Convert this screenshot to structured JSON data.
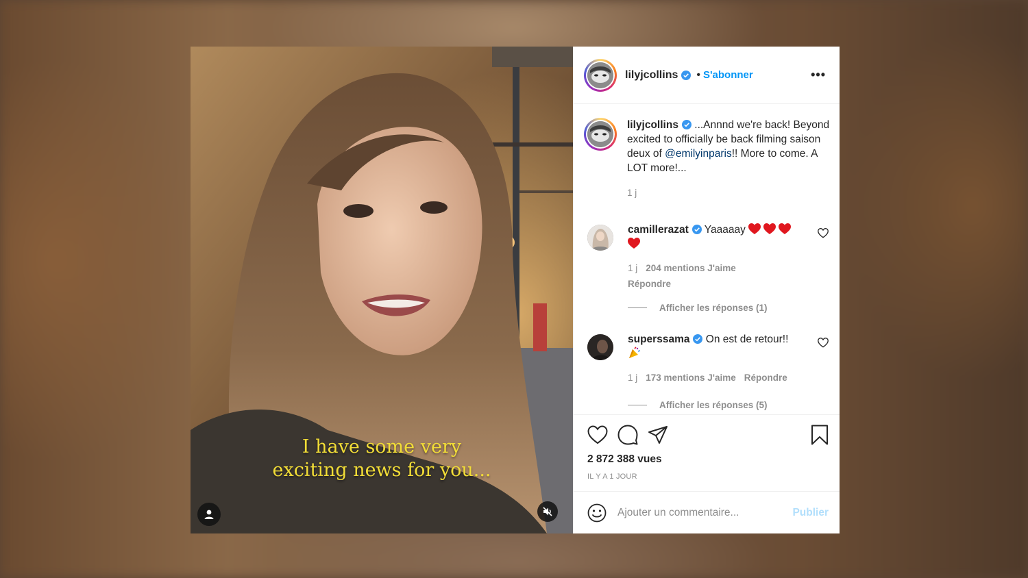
{
  "post": {
    "author": {
      "username": "lilyjcollins",
      "follow_label": "S'abonner",
      "more_label": "•••",
      "separator": "•"
    },
    "video": {
      "caption_line1": "I have some very",
      "caption_line2": "exciting news for you...",
      "user_icon": "user-icon",
      "mute_icon": "muted-speaker-icon"
    },
    "caption": {
      "username": "lilyjcollins",
      "text_before": "...Annnd we're back! Beyond excited to officially be back filming saison deux of ",
      "mention": "@emilyinparis",
      "text_after": "!! More to come. A LOT more!...",
      "time": "1 j"
    },
    "comments": [
      {
        "username": "camillerazat",
        "text": "Yaaaaay",
        "emoji": "red-heart-emoji",
        "time": "1 j",
        "likes": "204 mentions J'aime",
        "reply_label": "Répondre",
        "view_replies": "Afficher les réponses (1)"
      },
      {
        "username": "superssama",
        "text": "On est de retour!!",
        "emoji": "party-popper-emoji",
        "time": "1 j",
        "likes": "173 mentions J'aime",
        "reply_label": "Répondre",
        "view_replies": "Afficher les réponses (5)"
      }
    ],
    "actions": {
      "icons": [
        "heart-icon",
        "comment-icon",
        "share-icon",
        "bookmark-icon"
      ],
      "views": "2 872 388 vues",
      "timestamp": "IL Y A 1 JOUR"
    },
    "add_comment": {
      "placeholder": "Ajouter un commentaire...",
      "publish_label": "Publier",
      "emoji_icon": "smiley-icon"
    }
  },
  "colors": {
    "accent": "#0095f6",
    "publish_disabled": "#b2dffc",
    "caption_yellow": "#f2dd37",
    "emoji_heart": "#e0171f",
    "text": "#262626",
    "muted": "#8e8e8e"
  }
}
